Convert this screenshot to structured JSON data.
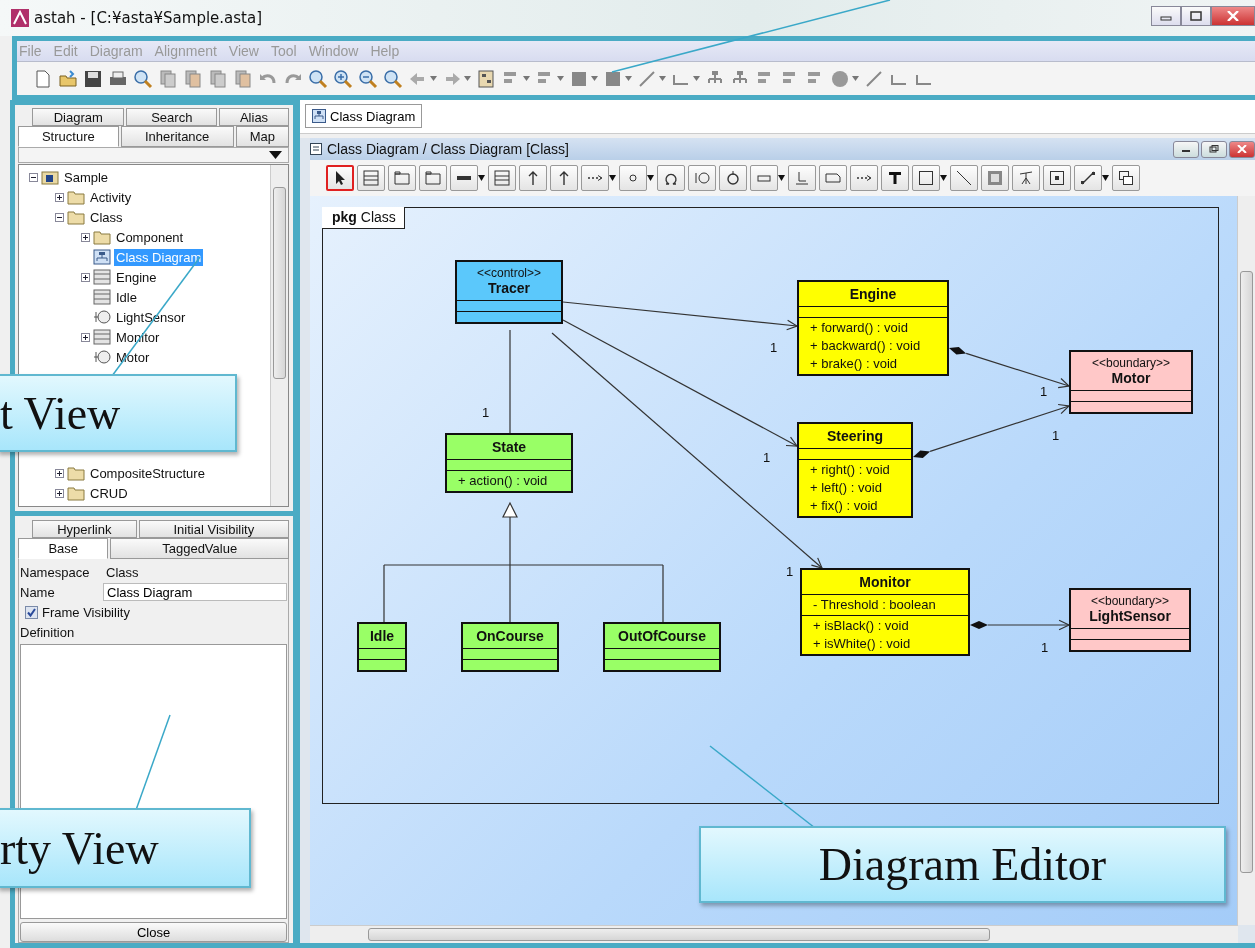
{
  "window": {
    "title": "astah - [C:¥asta¥Sample.asta]"
  },
  "menu": [
    "File",
    "Edit",
    "Diagram",
    "Alignment",
    "View",
    "Tool",
    "Window",
    "Help"
  ],
  "project_view": {
    "tabs_row_1": [
      {
        "label": "Diagram",
        "selected": false
      },
      {
        "label": "Search",
        "selected": false
      },
      {
        "label": "Alias",
        "selected": false
      }
    ],
    "tabs_row_2": [
      {
        "label": "Structure",
        "selected": true
      },
      {
        "label": "Inheritance",
        "selected": false
      },
      {
        "label": "Map",
        "selected": false
      }
    ],
    "tree": [
      {
        "label": "Sample",
        "kind": "project",
        "expanded": true,
        "selected": false,
        "children": [
          {
            "label": "Activity",
            "kind": "folder",
            "expanded": false,
            "selected": false
          },
          {
            "label": "Class",
            "kind": "folder",
            "expanded": true,
            "selected": false,
            "children": [
              {
                "label": "Component",
                "kind": "folder",
                "expanded": false,
                "selected": false
              },
              {
                "label": "Class Diagram",
                "kind": "diagram",
                "selected": true
              },
              {
                "label": "Engine",
                "kind": "class",
                "expanded": false,
                "selected": false
              },
              {
                "label": "Idle",
                "kind": "class",
                "selected": false
              },
              {
                "label": "LightSensor",
                "kind": "interface",
                "selected": false
              },
              {
                "label": "Monitor",
                "kind": "class",
                "expanded": false,
                "selected": false
              },
              {
                "label": "Motor",
                "kind": "interface",
                "selected": false
              }
            ]
          },
          {
            "label": "CompositeStructure",
            "kind": "folder",
            "expanded": false,
            "selected": false
          },
          {
            "label": "CRUD",
            "kind": "folder",
            "expanded": false,
            "selected": false
          }
        ]
      }
    ]
  },
  "property_view": {
    "tabs_row_1": [
      {
        "label": "Hyperlink",
        "selected": false
      },
      {
        "label": "Initial Visibility",
        "selected": false
      }
    ],
    "tabs_row_2": [
      {
        "label": "Base",
        "selected": true
      },
      {
        "label": "TaggedValue",
        "selected": false
      }
    ],
    "namespace_label": "Namespace",
    "namespace_value": "Class",
    "name_label": "Name",
    "name_value": "Class Diagram",
    "frame_visibility": {
      "label": "Frame Visibility",
      "checked": true
    },
    "definition_label": "Definition",
    "close_button": "Close"
  },
  "editor_tabs": [
    {
      "label": "Class Diagram",
      "selected": true
    }
  ],
  "editor": {
    "title": "Class Diagram / Class Diagram [Class]",
    "tools": [
      {
        "selected": true
      },
      {
        "selected": false
      },
      {
        "selected": false
      },
      {
        "selected": false
      },
      {
        "selected": false
      },
      {
        "selected": false
      },
      {
        "selected": false
      },
      {
        "selected": false
      },
      {
        "selected": false
      },
      {
        "selected": false
      },
      {
        "selected": false
      },
      {
        "selected": false
      },
      {
        "selected": false
      },
      {
        "selected": false
      },
      {
        "selected": false
      },
      {
        "selected": false
      },
      {
        "selected": false
      },
      {
        "selected": false
      },
      {
        "selected": false
      },
      {
        "selected": false
      },
      {
        "selected": false
      },
      {
        "selected": false
      },
      {
        "selected": false
      },
      {
        "selected": false
      },
      {
        "selected": false
      }
    ],
    "frame_label": "**pkg** Class",
    "classes": [
      {
        "name": "Tracer",
        "stereotype": "<<control>>",
        "color": "#5bc8fb"
      },
      {
        "name": "Engine",
        "color": "#ffff00",
        "operations": [
          "+ forward() : void",
          "+ backward() : void",
          "+ brake() : void"
        ]
      },
      {
        "name": "Motor",
        "stereotype": "<<boundary>>",
        "color": "#ffc8c8"
      },
      {
        "name": "State",
        "color": "#99ff66",
        "operations": [
          "+ action() : void"
        ]
      },
      {
        "name": "Steering",
        "color": "#ffff00",
        "operations": [
          "+ right() : void",
          "+ left() : void",
          "+ fix() : void"
        ]
      },
      {
        "name": "Monitor",
        "color": "#ffff00",
        "attributes": [
          "- Threshold : boolean"
        ],
        "operations": [
          "+ isBlack() : void",
          "+ isWhite() : void"
        ]
      },
      {
        "name": "LightSensor",
        "stereotype": "<<boundary>>",
        "color": "#ffc8c8"
      },
      {
        "name": "Idle",
        "color": "#99ff66"
      },
      {
        "name": "OnCourse",
        "color": "#99ff66"
      },
      {
        "name": "OutOfCourse",
        "color": "#99ff66"
      }
    ],
    "edges": [
      {
        "kind": "association",
        "label": "1"
      },
      {
        "kind": "association",
        "label": "1"
      },
      {
        "kind": "association",
        "label": "1"
      },
      {
        "kind": "link",
        "label": "1"
      },
      {
        "kind": "composition",
        "label": "1"
      },
      {
        "kind": "composition",
        "label": "1"
      },
      {
        "kind": "composition",
        "label": "1"
      },
      {
        "kind": "generalization"
      }
    ]
  },
  "callouts": [
    "t View",
    "rty View",
    "Diagram Editor"
  ]
}
